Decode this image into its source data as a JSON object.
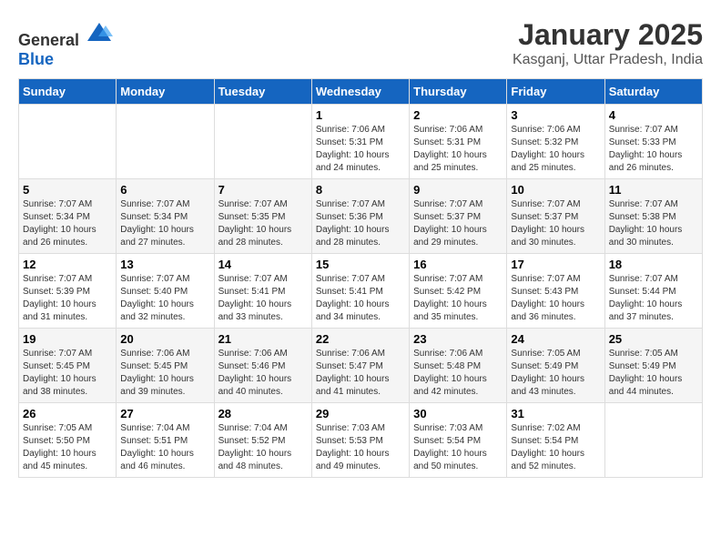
{
  "header": {
    "logo_general": "General",
    "logo_blue": "Blue",
    "month": "January 2025",
    "location": "Kasganj, Uttar Pradesh, India"
  },
  "days_of_week": [
    "Sunday",
    "Monday",
    "Tuesday",
    "Wednesday",
    "Thursday",
    "Friday",
    "Saturday"
  ],
  "weeks": [
    [
      {
        "day": "",
        "sunrise": "",
        "sunset": "",
        "daylight": ""
      },
      {
        "day": "",
        "sunrise": "",
        "sunset": "",
        "daylight": ""
      },
      {
        "day": "",
        "sunrise": "",
        "sunset": "",
        "daylight": ""
      },
      {
        "day": "1",
        "sunrise": "Sunrise: 7:06 AM",
        "sunset": "Sunset: 5:31 PM",
        "daylight": "Daylight: 10 hours and 24 minutes."
      },
      {
        "day": "2",
        "sunrise": "Sunrise: 7:06 AM",
        "sunset": "Sunset: 5:31 PM",
        "daylight": "Daylight: 10 hours and 25 minutes."
      },
      {
        "day": "3",
        "sunrise": "Sunrise: 7:06 AM",
        "sunset": "Sunset: 5:32 PM",
        "daylight": "Daylight: 10 hours and 25 minutes."
      },
      {
        "day": "4",
        "sunrise": "Sunrise: 7:07 AM",
        "sunset": "Sunset: 5:33 PM",
        "daylight": "Daylight: 10 hours and 26 minutes."
      }
    ],
    [
      {
        "day": "5",
        "sunrise": "Sunrise: 7:07 AM",
        "sunset": "Sunset: 5:34 PM",
        "daylight": "Daylight: 10 hours and 26 minutes."
      },
      {
        "day": "6",
        "sunrise": "Sunrise: 7:07 AM",
        "sunset": "Sunset: 5:34 PM",
        "daylight": "Daylight: 10 hours and 27 minutes."
      },
      {
        "day": "7",
        "sunrise": "Sunrise: 7:07 AM",
        "sunset": "Sunset: 5:35 PM",
        "daylight": "Daylight: 10 hours and 28 minutes."
      },
      {
        "day": "8",
        "sunrise": "Sunrise: 7:07 AM",
        "sunset": "Sunset: 5:36 PM",
        "daylight": "Daylight: 10 hours and 28 minutes."
      },
      {
        "day": "9",
        "sunrise": "Sunrise: 7:07 AM",
        "sunset": "Sunset: 5:37 PM",
        "daylight": "Daylight: 10 hours and 29 minutes."
      },
      {
        "day": "10",
        "sunrise": "Sunrise: 7:07 AM",
        "sunset": "Sunset: 5:37 PM",
        "daylight": "Daylight: 10 hours and 30 minutes."
      },
      {
        "day": "11",
        "sunrise": "Sunrise: 7:07 AM",
        "sunset": "Sunset: 5:38 PM",
        "daylight": "Daylight: 10 hours and 30 minutes."
      }
    ],
    [
      {
        "day": "12",
        "sunrise": "Sunrise: 7:07 AM",
        "sunset": "Sunset: 5:39 PM",
        "daylight": "Daylight: 10 hours and 31 minutes."
      },
      {
        "day": "13",
        "sunrise": "Sunrise: 7:07 AM",
        "sunset": "Sunset: 5:40 PM",
        "daylight": "Daylight: 10 hours and 32 minutes."
      },
      {
        "day": "14",
        "sunrise": "Sunrise: 7:07 AM",
        "sunset": "Sunset: 5:41 PM",
        "daylight": "Daylight: 10 hours and 33 minutes."
      },
      {
        "day": "15",
        "sunrise": "Sunrise: 7:07 AM",
        "sunset": "Sunset: 5:41 PM",
        "daylight": "Daylight: 10 hours and 34 minutes."
      },
      {
        "day": "16",
        "sunrise": "Sunrise: 7:07 AM",
        "sunset": "Sunset: 5:42 PM",
        "daylight": "Daylight: 10 hours and 35 minutes."
      },
      {
        "day": "17",
        "sunrise": "Sunrise: 7:07 AM",
        "sunset": "Sunset: 5:43 PM",
        "daylight": "Daylight: 10 hours and 36 minutes."
      },
      {
        "day": "18",
        "sunrise": "Sunrise: 7:07 AM",
        "sunset": "Sunset: 5:44 PM",
        "daylight": "Daylight: 10 hours and 37 minutes."
      }
    ],
    [
      {
        "day": "19",
        "sunrise": "Sunrise: 7:07 AM",
        "sunset": "Sunset: 5:45 PM",
        "daylight": "Daylight: 10 hours and 38 minutes."
      },
      {
        "day": "20",
        "sunrise": "Sunrise: 7:06 AM",
        "sunset": "Sunset: 5:45 PM",
        "daylight": "Daylight: 10 hours and 39 minutes."
      },
      {
        "day": "21",
        "sunrise": "Sunrise: 7:06 AM",
        "sunset": "Sunset: 5:46 PM",
        "daylight": "Daylight: 10 hours and 40 minutes."
      },
      {
        "day": "22",
        "sunrise": "Sunrise: 7:06 AM",
        "sunset": "Sunset: 5:47 PM",
        "daylight": "Daylight: 10 hours and 41 minutes."
      },
      {
        "day": "23",
        "sunrise": "Sunrise: 7:06 AM",
        "sunset": "Sunset: 5:48 PM",
        "daylight": "Daylight: 10 hours and 42 minutes."
      },
      {
        "day": "24",
        "sunrise": "Sunrise: 7:05 AM",
        "sunset": "Sunset: 5:49 PM",
        "daylight": "Daylight: 10 hours and 43 minutes."
      },
      {
        "day": "25",
        "sunrise": "Sunrise: 7:05 AM",
        "sunset": "Sunset: 5:49 PM",
        "daylight": "Daylight: 10 hours and 44 minutes."
      }
    ],
    [
      {
        "day": "26",
        "sunrise": "Sunrise: 7:05 AM",
        "sunset": "Sunset: 5:50 PM",
        "daylight": "Daylight: 10 hours and 45 minutes."
      },
      {
        "day": "27",
        "sunrise": "Sunrise: 7:04 AM",
        "sunset": "Sunset: 5:51 PM",
        "daylight": "Daylight: 10 hours and 46 minutes."
      },
      {
        "day": "28",
        "sunrise": "Sunrise: 7:04 AM",
        "sunset": "Sunset: 5:52 PM",
        "daylight": "Daylight: 10 hours and 48 minutes."
      },
      {
        "day": "29",
        "sunrise": "Sunrise: 7:03 AM",
        "sunset": "Sunset: 5:53 PM",
        "daylight": "Daylight: 10 hours and 49 minutes."
      },
      {
        "day": "30",
        "sunrise": "Sunrise: 7:03 AM",
        "sunset": "Sunset: 5:54 PM",
        "daylight": "Daylight: 10 hours and 50 minutes."
      },
      {
        "day": "31",
        "sunrise": "Sunrise: 7:02 AM",
        "sunset": "Sunset: 5:54 PM",
        "daylight": "Daylight: 10 hours and 52 minutes."
      },
      {
        "day": "",
        "sunrise": "",
        "sunset": "",
        "daylight": ""
      }
    ]
  ]
}
